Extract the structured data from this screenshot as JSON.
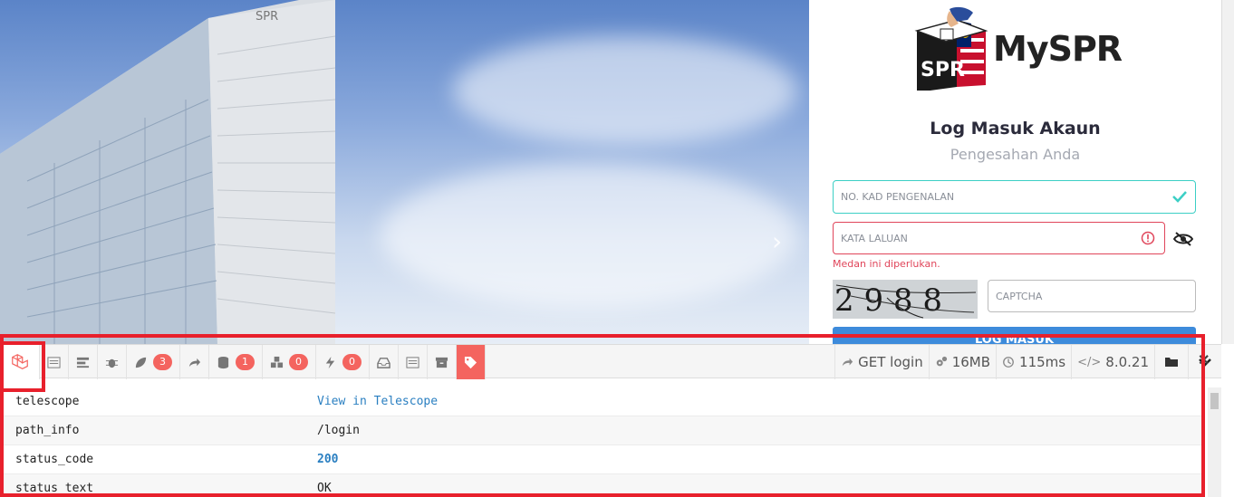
{
  "panel": {
    "brand": "MySPR",
    "logo_text": "SPR",
    "title": "Log Masuk Akaun",
    "subtitle": "Pengesahan Anda",
    "ic_placeholder": "NO. KAD PENGENALAN",
    "password_placeholder": "KATA LALUAN",
    "error_text": "Medan ini diperlukan.",
    "captcha_placeholder": "CAPTCHA",
    "captcha_text": "2 9 8 8",
    "login_button": "LOG MASUK"
  },
  "colors": {
    "valid": "#3ccfc5",
    "error": "#e0455a",
    "primary": "#3d8bdb",
    "debug_accent": "#f4645f",
    "highlight": "#e8202c"
  },
  "debugbar": {
    "badges": {
      "views": "3",
      "queries": "1",
      "models": "0",
      "events": "0"
    },
    "request": "GET login",
    "memory": "16MB",
    "time": "115ms",
    "php_version": "8.0.21",
    "rows": [
      {
        "key": "telescope",
        "value": "View in Telescope"
      },
      {
        "key": "path_info",
        "value": "/login"
      },
      {
        "key": "status_code",
        "value": "200"
      },
      {
        "key": "status_text",
        "value": "OK"
      }
    ]
  }
}
